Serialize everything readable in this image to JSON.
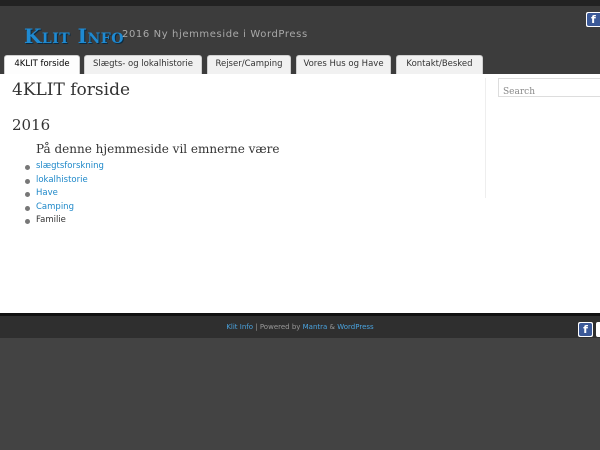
{
  "header": {
    "site_title": "Klit Info",
    "tagline": "2016 Ny hjemmeside i WordPress",
    "social_icon": "facebook-icon"
  },
  "nav": {
    "tabs": [
      {
        "label": "4KLIT forside",
        "active": true
      },
      {
        "label": "Slægts- og lokalhistorie",
        "active": false
      },
      {
        "label": "Rejser/Camping",
        "active": false
      },
      {
        "label": "Vores Hus og Have",
        "active": false
      },
      {
        "label": "Kontakt/Besked",
        "active": false
      }
    ]
  },
  "main": {
    "page_title": "4KLIT forside",
    "year": "2016",
    "subhead": "På denne hjemmeside vil emnerne være",
    "topics": [
      {
        "label": "slægtsforskning",
        "link": true
      },
      {
        "label": "lokalhistorie",
        "link": true
      },
      {
        "label": "Have",
        "link": true
      },
      {
        "label": "Camping",
        "link": true
      },
      {
        "label": "Familie",
        "link": false
      }
    ]
  },
  "sidebar": {
    "search": {
      "placeholder": "Search"
    }
  },
  "footer": {
    "site_link": "Klit Info",
    "separator": " | Powered by ",
    "theme_link": "Mantra",
    "amp": " & ",
    "wp_link": "WordPress"
  },
  "colors": {
    "accent": "#1f8ad2",
    "link": "#1e88c9",
    "header_bg": "#3c3c3c",
    "page_bg": "#434343"
  }
}
